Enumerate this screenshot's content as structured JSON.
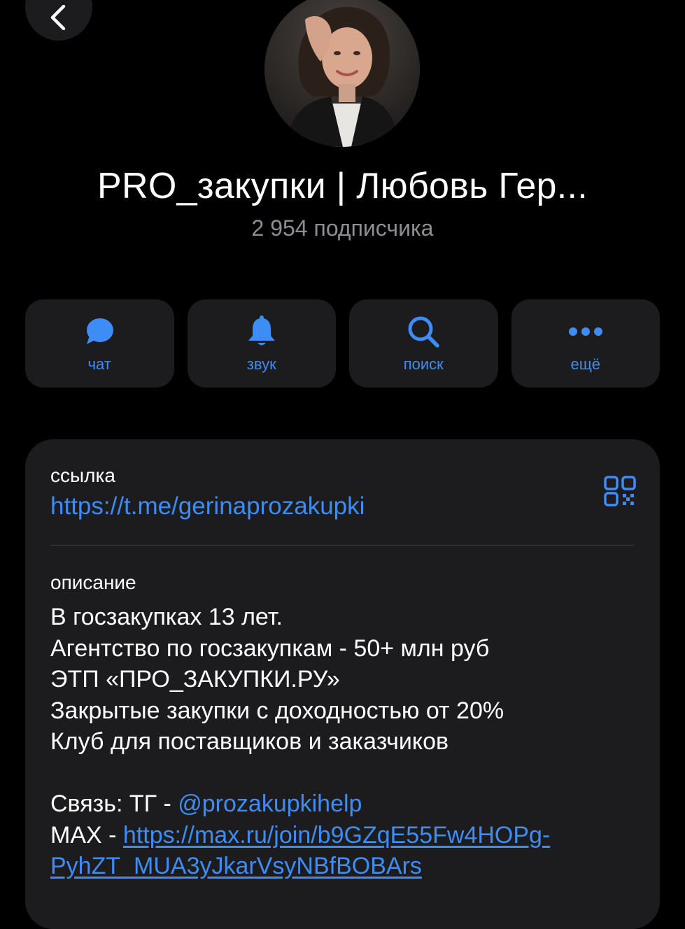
{
  "channel": {
    "title": "PRO_закупки | Любовь Гер...",
    "subscribers": "2 954 подписчика"
  },
  "actions": [
    {
      "label": "чат",
      "icon": "chat-bubble-icon"
    },
    {
      "label": "звук",
      "icon": "bell-icon"
    },
    {
      "label": "поиск",
      "icon": "search-icon"
    },
    {
      "label": "ещё",
      "icon": "more-dots-icon"
    }
  ],
  "link": {
    "caption": "ссылка",
    "url": "https://t.me/gerinaprozakupki"
  },
  "description": {
    "caption": "описание",
    "lines": [
      "В госзакупках 13 лет.",
      "Агентство по госзакупкам - 50+ млн руб",
      "ЭТП «ПРО_ЗАКУПКИ.РУ»",
      "Закрытые закупки с доходностью от 20%",
      "Клуб для поставщиков и заказчиков"
    ],
    "contact_prefix": "Связь: ТГ - ",
    "contact_handle": "@prozakupkihelp",
    "max_prefix": "MAX - ",
    "max_link_line1": "https://max.ru/join/b9GZqE55Fw4HOPg-",
    "max_link_line2": "PyhZT_MUA3yJkarVsyNBfBOBArs"
  },
  "colors": {
    "background": "#000000",
    "card": "#1c1c1e",
    "accent": "#3e8cf5",
    "secondary_text": "#8d8d93"
  }
}
